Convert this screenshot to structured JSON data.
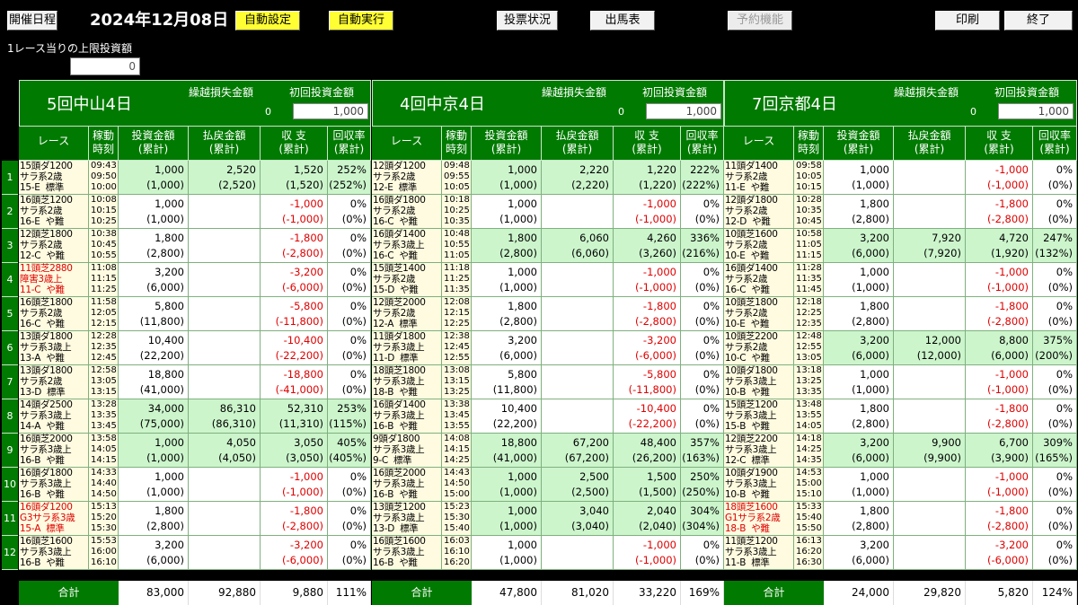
{
  "toolbar": {
    "schedule": "開催日程",
    "date": "2024年12月08日",
    "auto_setting": "自動設定",
    "auto_exec": "自動実行",
    "vote_status": "投票状況",
    "entry_table": "出馬表",
    "reservation": "予約機能",
    "print": "印刷",
    "exit": "終了"
  },
  "limit": {
    "label": "1レース当りの上限投資額",
    "value": "0"
  },
  "columns": {
    "race": "レース",
    "time": "稼動\n時刻",
    "invest": "投資金額\n(累計)",
    "payout": "払戻金額\n(累計)",
    "balance": "収 支\n(累計)",
    "rate": "回収率\n(累計)",
    "carry_label": "繰越損失金額",
    "init_label": "初回投資金額",
    "total": "合計"
  },
  "row_numbers": [
    "1",
    "2",
    "3",
    "4",
    "5",
    "6",
    "7",
    "8",
    "9",
    "10",
    "11",
    "12"
  ],
  "venues": [
    {
      "name": "5回中山4日",
      "carry": "0",
      "init": "1,000",
      "rows": [
        {
          "race": "15頭ダ1200\nサラ系2歳\n15-E  標準",
          "time": "09:43\n09:50\n10:00",
          "invest": "1,000\n(1,000)",
          "payout": "2,520\n(2,520)",
          "balance": "1,520\n(1,520)",
          "rate": "252%\n(252%)",
          "win": true,
          "neg": false,
          "red": false
        },
        {
          "race": "16頭芝1200\nサラ系2歳\n16-E  や難",
          "time": "10:08\n10:15\n10:25",
          "invest": "1,000\n(1,000)",
          "payout": "",
          "balance": "-1,000\n(-1,000)",
          "rate": "0%\n(0%)",
          "win": false,
          "neg": true,
          "red": false
        },
        {
          "race": "12頭芝1800\nサラ系2歳\n12-C  や難",
          "time": "10:38\n10:45\n10:55",
          "invest": "1,800\n(2,800)",
          "payout": "",
          "balance": "-1,800\n(-2,800)",
          "rate": "0%\n(0%)",
          "win": false,
          "neg": true,
          "red": false
        },
        {
          "race": "11頭芝2880\n障害3歳上\n11-C  や難",
          "time": "11:08\n11:15\n11:25",
          "invest": "3,200\n(6,000)",
          "payout": "",
          "balance": "-3,200\n(-6,000)",
          "rate": "0%\n(0%)",
          "win": false,
          "neg": true,
          "red": true
        },
        {
          "race": "16頭芝1800\nサラ系2歳\n16-C  や難",
          "time": "11:58\n12:05\n12:15",
          "invest": "5,800\n(11,800)",
          "payout": "",
          "balance": "-5,800\n(-11,800)",
          "rate": "0%\n(0%)",
          "win": false,
          "neg": true,
          "red": false
        },
        {
          "race": "13頭ダ1800\nサラ系3歳上\n13-A  や難",
          "time": "12:28\n12:35\n12:45",
          "invest": "10,400\n(22,200)",
          "payout": "",
          "balance": "-10,400\n(-22,200)",
          "rate": "0%\n(0%)",
          "win": false,
          "neg": true,
          "red": false
        },
        {
          "race": "13頭ダ1800\nサラ系2歳\n13-D  標準",
          "time": "12:58\n13:05\n13:15",
          "invest": "18,800\n(41,000)",
          "payout": "",
          "balance": "-18,800\n(-41,000)",
          "rate": "0%\n(0%)",
          "win": false,
          "neg": true,
          "red": false
        },
        {
          "race": "14頭ダ2500\nサラ系3歳上\n14-A  や難",
          "time": "13:28\n13:35\n13:45",
          "invest": "34,000\n(75,000)",
          "payout": "86,310\n(86,310)",
          "balance": "52,310\n(11,310)",
          "rate": "253%\n(115%)",
          "win": true,
          "neg": false,
          "red": false
        },
        {
          "race": "16頭芝2000\nサラ系3歳上\n16-B  や難",
          "time": "13:58\n14:05\n14:15",
          "invest": "1,000\n(1,000)",
          "payout": "4,050\n(4,050)",
          "balance": "3,050\n(3,050)",
          "rate": "405%\n(405%)",
          "win": true,
          "neg": false,
          "red": false
        },
        {
          "race": "16頭ダ1800\nサラ系3歳上\n16-B  や難",
          "time": "14:33\n14:40\n14:50",
          "invest": "1,000\n(1,000)",
          "payout": "",
          "balance": "-1,000\n(-1,000)",
          "rate": "0%\n(0%)",
          "win": false,
          "neg": true,
          "red": false
        },
        {
          "race": "16頭ダ1200\nG3サラ系3歳\n15-A  標準",
          "time": "15:13\n15:20\n15:30",
          "invest": "1,800\n(2,800)",
          "payout": "",
          "balance": "-1,800\n(-2,800)",
          "rate": "0%\n(0%)",
          "win": false,
          "neg": true,
          "red": true
        },
        {
          "race": "16頭芝1600\nサラ系3歳上\n16-B  や難",
          "time": "15:53\n16:00\n16:10",
          "invest": "3,200\n(6,000)",
          "payout": "",
          "balance": "-3,200\n(-6,000)",
          "rate": "0%\n(0%)",
          "win": false,
          "neg": true,
          "red": false
        }
      ],
      "total": {
        "invest": "83,000",
        "payout": "92,880",
        "balance": "9,880",
        "rate": "111%"
      }
    },
    {
      "name": "4回中京4日",
      "carry": "0",
      "init": "1,000",
      "rows": [
        {
          "race": "12頭ダ1200\nサラ系2歳\n12-E  標準",
          "time": "09:48\n09:55\n10:05",
          "invest": "1,000\n(1,000)",
          "payout": "2,220\n(2,220)",
          "balance": "1,220\n(1,220)",
          "rate": "222%\n(222%)",
          "win": true,
          "neg": false,
          "red": false
        },
        {
          "race": "16頭ダ1800\nサラ系2歳\n16-C  や難",
          "time": "10:18\n10:25\n10:35",
          "invest": "1,000\n(1,000)",
          "payout": "",
          "balance": "-1,000\n(-1,000)",
          "rate": "0%\n(0%)",
          "win": false,
          "neg": true,
          "red": false
        },
        {
          "race": "16頭ダ1400\nサラ系3歳上\n16-C  や難",
          "time": "10:48\n10:55\n11:05",
          "invest": "1,800\n(2,800)",
          "payout": "6,060\n(6,060)",
          "balance": "4,260\n(3,260)",
          "rate": "336%\n(216%)",
          "win": true,
          "neg": false,
          "red": false
        },
        {
          "race": "15頭芝1400\nサラ系2歳\n15-D  や難",
          "time": "11:18\n11:25\n11:35",
          "invest": "1,000\n(1,000)",
          "payout": "",
          "balance": "-1,000\n(-1,000)",
          "rate": "0%\n(0%)",
          "win": false,
          "neg": true,
          "red": false
        },
        {
          "race": "12頭芝2000\nサラ系2歳\n12-A  標準",
          "time": "12:08\n12:15\n12:25",
          "invest": "1,800\n(2,800)",
          "payout": "",
          "balance": "-1,800\n(-2,800)",
          "rate": "0%\n(0%)",
          "win": false,
          "neg": true,
          "red": false
        },
        {
          "race": "11頭ダ1800\nサラ系3歳上\n11-D  標準",
          "time": "12:38\n12:45\n12:55",
          "invest": "3,200\n(6,000)",
          "payout": "",
          "balance": "-3,200\n(-6,000)",
          "rate": "0%\n(0%)",
          "win": false,
          "neg": true,
          "red": false
        },
        {
          "race": "18頭芝1800\nサラ系3歳上\n18-B  や難",
          "time": "13:08\n13:15\n13:25",
          "invest": "5,800\n(11,800)",
          "payout": "",
          "balance": "-5,800\n(-11,800)",
          "rate": "0%\n(0%)",
          "win": false,
          "neg": true,
          "red": false
        },
        {
          "race": "16頭ダ1400\nサラ系3歳上\n16-B  や難",
          "time": "13:38\n13:45\n13:55",
          "invest": "10,400\n(22,200)",
          "payout": "",
          "balance": "-10,400\n(-22,200)",
          "rate": "0%\n(0%)",
          "win": false,
          "neg": true,
          "red": false
        },
        {
          "race": "9頭ダ1800\nサラ系3歳上\n9-C  標準",
          "time": "14:08\n14:15\n14:25",
          "invest": "18,800\n(41,000)",
          "payout": "67,200\n(67,200)",
          "balance": "48,400\n(26,200)",
          "rate": "357%\n(163%)",
          "win": true,
          "neg": false,
          "red": false
        },
        {
          "race": "16頭芝2000\nサラ系3歳上\n16-B  や難",
          "time": "14:43\n14:50\n15:00",
          "invest": "1,000\n(1,000)",
          "payout": "2,500\n(2,500)",
          "balance": "1,500\n(1,500)",
          "rate": "250%\n(250%)",
          "win": true,
          "neg": false,
          "red": false
        },
        {
          "race": "13頭芝1200\nサラ系3歳上\n13-D  標準",
          "time": "15:23\n15:30\n15:40",
          "invest": "1,000\n(1,000)",
          "payout": "3,040\n(3,040)",
          "balance": "2,040\n(2,040)",
          "rate": "304%\n(304%)",
          "win": true,
          "neg": false,
          "red": false
        },
        {
          "race": "16頭芝1600\nサラ系3歳上\n16-B  や難",
          "time": "16:03\n16:10\n16:20",
          "invest": "1,000\n(1,000)",
          "payout": "",
          "balance": "-1,000\n(-1,000)",
          "rate": "0%\n(0%)",
          "win": false,
          "neg": true,
          "red": false
        }
      ],
      "total": {
        "invest": "47,800",
        "payout": "81,020",
        "balance": "33,220",
        "rate": "169%"
      }
    },
    {
      "name": "7回京都4日",
      "carry": "0",
      "init": "1,000",
      "rows": [
        {
          "race": "11頭ダ1400\nサラ系2歳\n11-E  や難",
          "time": "09:58\n10:05\n10:15",
          "invest": "1,000\n(1,000)",
          "payout": "",
          "balance": "-1,000\n(-1,000)",
          "rate": "0%\n(0%)",
          "win": false,
          "neg": true,
          "red": false
        },
        {
          "race": "12頭ダ1800\nサラ系2歳\n12-D  や難",
          "time": "10:28\n10:35\n10:45",
          "invest": "1,800\n(2,800)",
          "payout": "",
          "balance": "-1,800\n(-2,800)",
          "rate": "0%\n(0%)",
          "win": false,
          "neg": true,
          "red": false
        },
        {
          "race": "10頭芝1600\nサラ系2歳\n10-E  や難",
          "time": "10:58\n11:05\n11:15",
          "invest": "3,200\n(6,000)",
          "payout": "7,920\n(7,920)",
          "balance": "4,720\n(1,920)",
          "rate": "247%\n(132%)",
          "win": true,
          "neg": false,
          "red": false
        },
        {
          "race": "16頭ダ1400\nサラ系2歳\n16-C  や難",
          "time": "11:28\n11:35\n11:45",
          "invest": "1,000\n(1,000)",
          "payout": "",
          "balance": "-1,000\n(-1,000)",
          "rate": "0%\n(0%)",
          "win": false,
          "neg": true,
          "red": false
        },
        {
          "race": "10頭芝1800\nサラ系2歳\n10-E  や難",
          "time": "12:18\n12:25\n12:35",
          "invest": "1,800\n(2,800)",
          "payout": "",
          "balance": "-1,800\n(-2,800)",
          "rate": "0%\n(0%)",
          "win": false,
          "neg": true,
          "red": false
        },
        {
          "race": "10頭芝2200\nサラ系2歳\n10-C  や難",
          "time": "12:48\n12:55\n13:05",
          "invest": "3,200\n(6,000)",
          "payout": "12,000\n(12,000)",
          "balance": "8,800\n(6,000)",
          "rate": "375%\n(200%)",
          "win": true,
          "neg": false,
          "red": false
        },
        {
          "race": "10頭ダ1800\nサラ系3歳上\n10-B  や難",
          "time": "13:18\n13:25\n13:35",
          "invest": "1,000\n(1,000)",
          "payout": "",
          "balance": "-1,000\n(-1,000)",
          "rate": "0%\n(0%)",
          "win": false,
          "neg": true,
          "red": false
        },
        {
          "race": "15頭芝1200\nサラ系3歳上\n15-B  や難",
          "time": "13:48\n13:55\n14:05",
          "invest": "1,800\n(2,800)",
          "payout": "",
          "balance": "-1,800\n(-2,800)",
          "rate": "0%\n(0%)",
          "win": false,
          "neg": true,
          "red": false
        },
        {
          "race": "12頭芝2200\nサラ系3歳上\n12-C  標準",
          "time": "14:18\n14:25\n14:35",
          "invest": "3,200\n(6,000)",
          "payout": "9,900\n(9,900)",
          "balance": "6,700\n(3,900)",
          "rate": "309%\n(165%)",
          "win": true,
          "neg": false,
          "red": false
        },
        {
          "race": "10頭ダ1900\nサラ系3歳上\n10-B  や難",
          "time": "14:53\n15:00\n15:10",
          "invest": "1,000\n(1,000)",
          "payout": "",
          "balance": "-1,000\n(-1,000)",
          "rate": "0%\n(0%)",
          "win": false,
          "neg": true,
          "red": false
        },
        {
          "race": "18頭芝1600\nG1サラ系2歳\n18-B  や難",
          "time": "15:33\n15:40\n15:50",
          "invest": "1,800\n(2,800)",
          "payout": "",
          "balance": "-1,800\n(-2,800)",
          "rate": "0%\n(0%)",
          "win": false,
          "neg": true,
          "red": true
        },
        {
          "race": "11頭芝1200\nサラ系3歳上\n11-B  標準",
          "time": "16:13\n16:20\n16:30",
          "invest": "3,200\n(6,000)",
          "payout": "",
          "balance": "-3,200\n(-6,000)",
          "rate": "0%\n(0%)",
          "win": false,
          "neg": true,
          "red": false
        }
      ],
      "total": {
        "invest": "24,000",
        "payout": "29,820",
        "balance": "5,820",
        "rate": "124%"
      }
    }
  ]
}
